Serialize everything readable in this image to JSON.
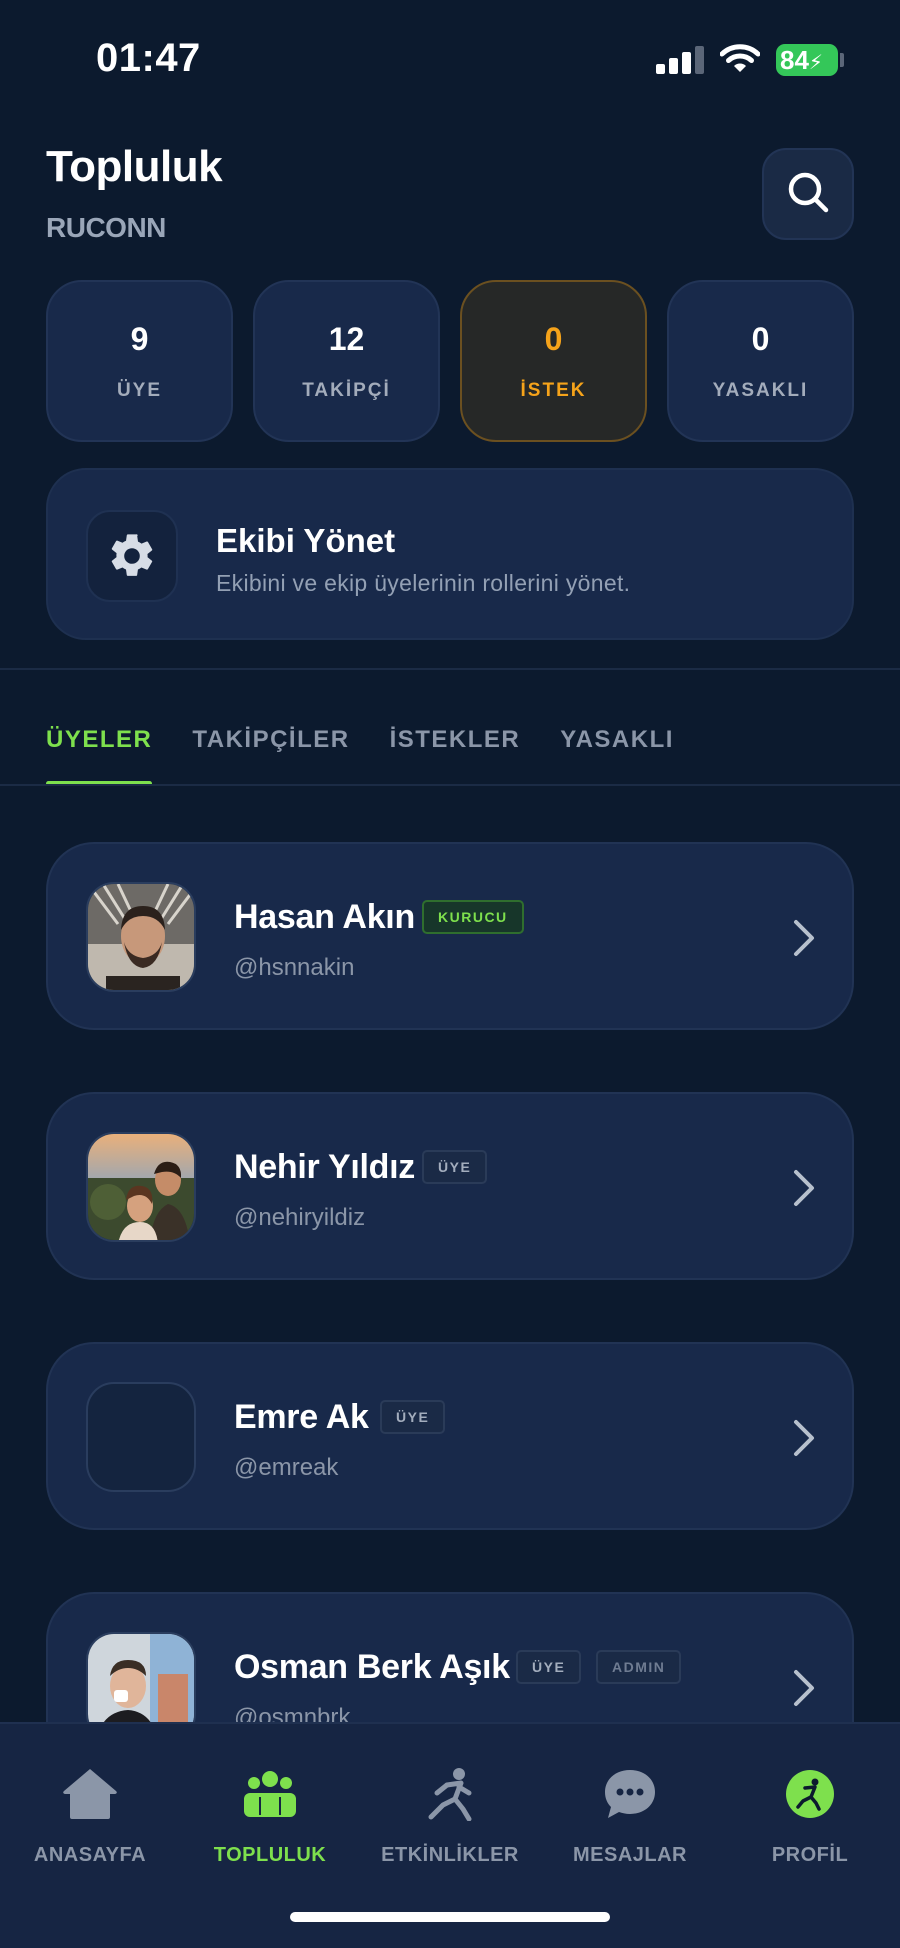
{
  "status_bar": {
    "time": "01:47",
    "battery": "84"
  },
  "header": {
    "title": "Topluluk",
    "subtitle": "RUCONN"
  },
  "stats": [
    {
      "value": "9",
      "label": "ÜYE"
    },
    {
      "value": "12",
      "label": "TAKİPÇİ"
    },
    {
      "value": "0",
      "label": "İSTEK"
    },
    {
      "value": "0",
      "label": "YASAKLI"
    }
  ],
  "manage": {
    "title": "Ekibi Yönet",
    "description": "Ekibini ve ekip üyelerinin rollerini yönet."
  },
  "tabs": [
    "ÜYELER",
    "TAKİPÇİLER",
    "İSTEKLER",
    "YASAKLI"
  ],
  "members": [
    {
      "name": "Hasan Akın",
      "handle": "@hsnnakin",
      "badges": [
        "KURUCU"
      ]
    },
    {
      "name": "Nehir Yıldız",
      "handle": "@nehiryildiz",
      "badges": [
        "ÜYE"
      ]
    },
    {
      "name": "Emre Ak",
      "handle": "@emreak",
      "badges": [
        "ÜYE"
      ]
    },
    {
      "name": "Osman Berk Aşık",
      "handle": "@osmnbrk",
      "badges": [
        "ÜYE",
        "ADMIN"
      ]
    }
  ],
  "nav": [
    {
      "label": "ANASAYFA",
      "icon": "home-icon"
    },
    {
      "label": "TOPLULUK",
      "icon": "community-icon"
    },
    {
      "label": "ETKİNLİKLER",
      "icon": "running-icon"
    },
    {
      "label": "MESAJLAR",
      "icon": "chat-icon"
    },
    {
      "label": "PROFİL",
      "icon": "profile-icon"
    }
  ],
  "colors": {
    "accent": "#7ee04d",
    "warning": "#f5a31a",
    "background": "#0c1a2e",
    "card": "#18294a"
  }
}
